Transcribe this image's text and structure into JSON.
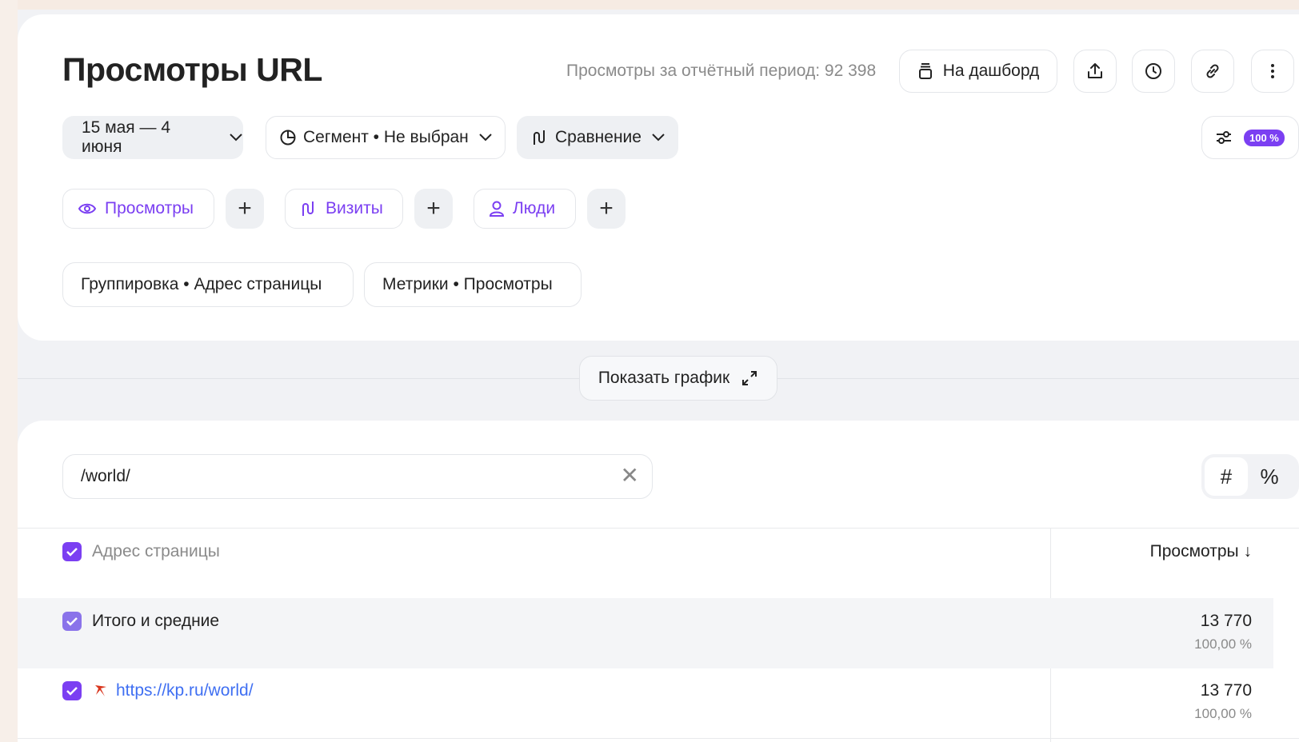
{
  "report": {
    "title": "Просмотры URL",
    "period_label": "Просмотры за отчётный период: 92 398"
  },
  "toolbar": {
    "dashboard_label": "На дашборд",
    "icons": [
      "export-icon",
      "history-icon",
      "link-icon",
      "more-icon"
    ]
  },
  "filters": {
    "date_range": "15 мая — 4 июня",
    "segment": "Сегмент • Не выбран",
    "comparison": "Сравнение",
    "sampling_badge": "100 %"
  },
  "metric_chips": [
    {
      "label": "Просмотры",
      "icon": "eye-icon"
    },
    {
      "label": "Визиты",
      "icon": "visits-icon"
    },
    {
      "label": "Люди",
      "icon": "person-icon"
    }
  ],
  "grouping": {
    "grouping_label": "Группировка • Адрес страницы",
    "metrics_label": "Метрики • Просмотры"
  },
  "chart_toggle": {
    "label": "Показать график"
  },
  "search": {
    "value": "/world/"
  },
  "view_toggle": {
    "absolute": "#",
    "percent": "%"
  },
  "table": {
    "col_dimension": "Адрес страницы",
    "col_metric": "Просмотры ↓",
    "total": {
      "label": "Итого и средние",
      "value": "13 770",
      "percent": "100,00 %"
    },
    "rows": [
      {
        "url": "https://kp.ru/world/",
        "value": "13 770",
        "percent": "100,00 %"
      }
    ]
  },
  "colors": {
    "accent": "#7b3ff2",
    "link": "#3f6ff2"
  }
}
